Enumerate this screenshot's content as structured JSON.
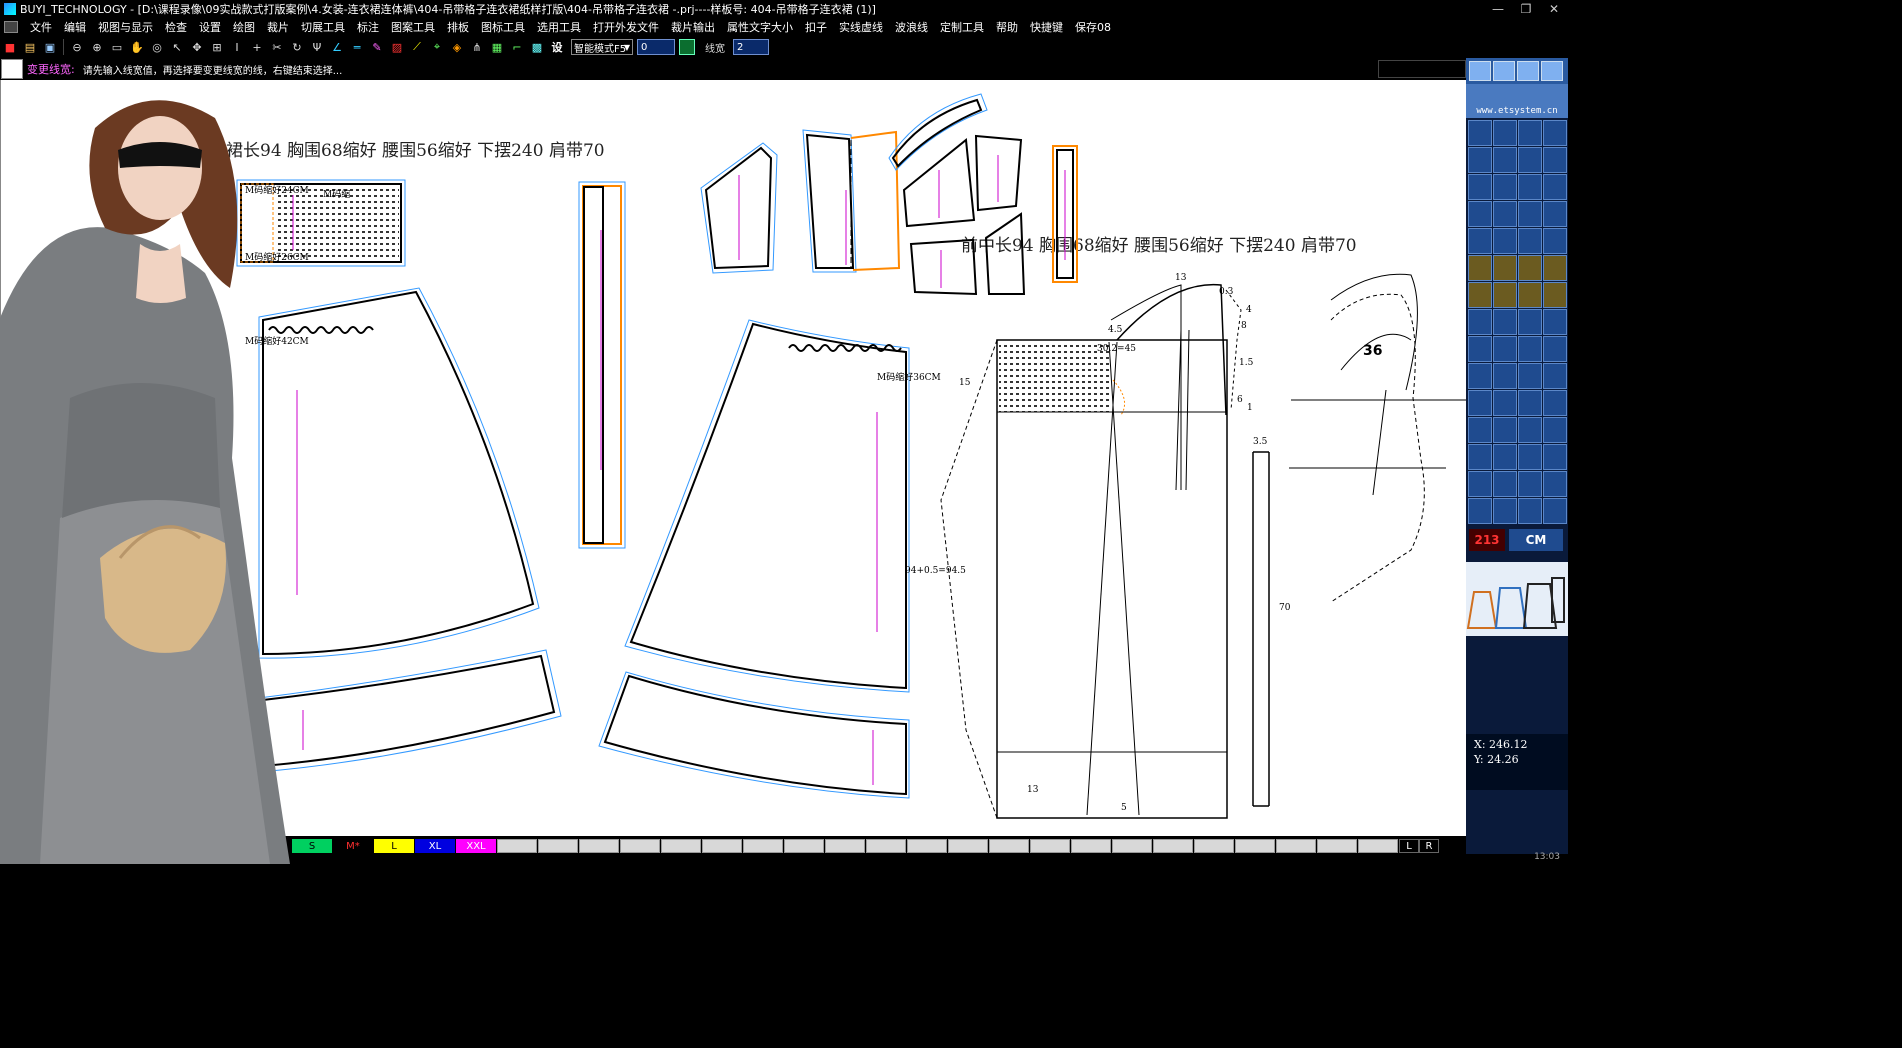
{
  "window": {
    "title": "BUYI_TECHNOLOGY - [D:\\课程录像\\09实战款式打版案例\\4.女装-连衣裙连体裤\\404-吊带格子连衣裙纸样打版\\404-吊带格子连衣裙 -.prj----样板号: 404-吊带格子连衣裙 (1)]",
    "minimize": "—",
    "restore": "❐",
    "close": "✕"
  },
  "menu": [
    "文件",
    "编辑",
    "视图与显示",
    "检查",
    "设置",
    "绘图",
    "裁片",
    "切展工具",
    "标注",
    "图案工具",
    "排板",
    "图标工具",
    "选用工具",
    "打开外发文件",
    "裁片输出",
    "属性文字大小",
    "扣子",
    "实线虚线",
    "波浪线",
    "定制工具",
    "帮助",
    "快捷键",
    "保存08"
  ],
  "toolbar": {
    "settings_glyph": "设",
    "mode_value": "智能模式F5",
    "field1_value": "0",
    "linewidth_label": "线宽",
    "linewidth_value": "2"
  },
  "status": {
    "tool_name": "变更线宽:",
    "prompt": "请先输入线宽值，再选择要变更线宽的线，右键结束选择..."
  },
  "canvas_text": {
    "spec_header_1": "裙长94  胸围68缩好  腰围56缩好  下摆240  肩带70",
    "spec_header_2": "前中长94  胸围68缩好  腰围56缩好  下摆240  肩带70",
    "bodice_tl": "M码缩好24CM",
    "bodice_tr": "M码缩",
    "bodice_bl": "M码缩好26CM",
    "skirt1_note": "M码缩好42CM",
    "skirt2_note": "M码缩好36CM",
    "skirt2_side": "94+0.5=94.5",
    "draft_13_top": "13",
    "draft_03": "0.3",
    "draft_4": "4",
    "draft_8": "8",
    "draft_45": "4.5",
    "draft_bust": "30.2=45",
    "draft_15": "15",
    "draft_1_5": "1.5",
    "draft_6": "6",
    "draft_1": "1",
    "draft_3_5": "3.5",
    "draft_70": "70",
    "draft_13_bottom": "13",
    "draft_5": "5",
    "mannequin_size": "36"
  },
  "right_panel": {
    "url": "www.etsystem.cn",
    "size_213": "213",
    "size_cm": "CM",
    "coord_x": "X:  246.12",
    "coord_y": "Y:  24.26"
  },
  "size_bar": [
    {
      "label": "S",
      "bg": "#00d060",
      "fg": "#000"
    },
    {
      "label": "M*",
      "bg": "#000000",
      "fg": "#ff3030"
    },
    {
      "label": "L",
      "bg": "#ffff00",
      "fg": "#000"
    },
    {
      "label": "XL",
      "bg": "#0000e0",
      "fg": "#fff"
    },
    {
      "label": "XXL",
      "bg": "#ff00ff",
      "fg": "#fff"
    }
  ],
  "size_bar_lr": [
    "L",
    "R"
  ],
  "bottom_time": "13:03",
  "colors": {
    "pattern_outline": "#000000",
    "seam_allowance": "#3399ff",
    "grainline": "#cc00cc",
    "facing": "#ff8800",
    "hatch": "#333333"
  }
}
